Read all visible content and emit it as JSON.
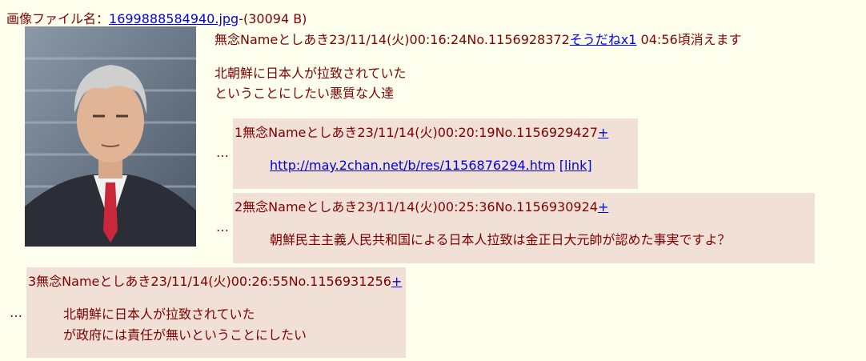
{
  "file": {
    "prefix": "画像ファイル名：",
    "name": "1699888584940.jpg",
    "size": "-(30094 B)"
  },
  "op": {
    "header": "無念Nameとしあき23/11/14(火)00:16:24No.1156928372",
    "soudane": "そうだねx1",
    "expire": " 04:56頃消えます",
    "lines": [
      "北朝鮮に日本人が拉致されていた",
      "ということにしたい悪質な人達"
    ]
  },
  "replies": [
    {
      "dots": "…",
      "header": "1無念Nameとしあき23/11/14(火)00:20:19No.1156929427",
      "plus": "+",
      "url": "http://may.2chan.net/b/res/1156876294.htm",
      "link_open": " [",
      "link_label": "link",
      "link_close": "]"
    },
    {
      "dots": "…",
      "header": "2無念Nameとしあき23/11/14(火)00:25:36No.1156930924",
      "plus": "+",
      "line1": "朝鮮民主主義人民共和国による日本人拉致は金正日大元帥が認めた事実ですよ？"
    },
    {
      "dots": "…",
      "header": "3無念Nameとしあき23/11/14(火)00:26:55No.1156931256",
      "plus": "+",
      "line1": "北朝鮮に日本人が拉致されていた",
      "line2": "が政府には責任が無いということにしたい"
    }
  ],
  "colors": {
    "background": "#ffffee",
    "text": "#800000",
    "link": "#0000ee",
    "reply_bg": "#f0e0d6"
  }
}
